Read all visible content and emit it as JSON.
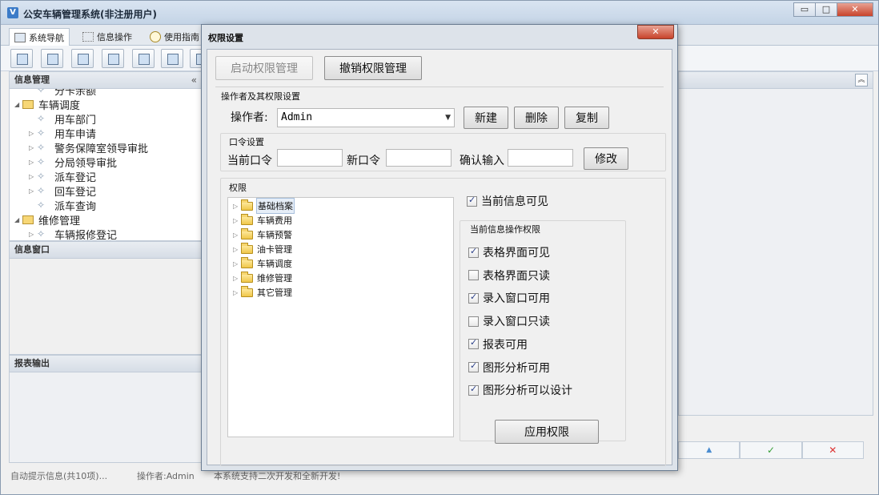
{
  "app": {
    "title": "公安车辆管理系统(非注册用户)",
    "icon": "app-logo-icon",
    "window_controls": {
      "minimize": "▭",
      "maximize": "□",
      "close": "✕"
    }
  },
  "tabs": [
    {
      "label": "系统导航",
      "icon": "monitor-icon"
    },
    {
      "label": "信息操作",
      "icon": "grid-icon"
    },
    {
      "label": "使用指南",
      "icon": "clock-icon"
    }
  ],
  "left": {
    "info_title": "信息管理",
    "collapse_glyph": "«",
    "tree": [
      {
        "label": "分卡余额",
        "level": 1,
        "kind": "tool",
        "arrow": ""
      },
      {
        "label": "车辆调度",
        "level": 0,
        "kind": "folder",
        "arrow": "◢"
      },
      {
        "label": "用车部门",
        "level": 1,
        "kind": "tool",
        "arrow": ""
      },
      {
        "label": "用车申请",
        "level": 1,
        "kind": "tool",
        "arrow": "▷"
      },
      {
        "label": "警务保障室领导审批",
        "level": 1,
        "kind": "tool",
        "arrow": "▷"
      },
      {
        "label": "分局领导审批",
        "level": 1,
        "kind": "tool",
        "arrow": "▷"
      },
      {
        "label": "派车登记",
        "level": 1,
        "kind": "tool",
        "arrow": "▷"
      },
      {
        "label": "回车登记",
        "level": 1,
        "kind": "tool",
        "arrow": "▷"
      },
      {
        "label": "派车查询",
        "level": 1,
        "kind": "tool",
        "arrow": ""
      },
      {
        "label": "维修管理",
        "level": 0,
        "kind": "folder",
        "arrow": "◢"
      },
      {
        "label": "车辆报修登记",
        "level": 1,
        "kind": "tool",
        "arrow": "▷"
      }
    ],
    "window_title": "信息窗口",
    "report_title": "报表输出"
  },
  "right": {
    "up_glyph": "︽",
    "actions": {
      "up": "▲",
      "ok": "✓",
      "cancel": "✕"
    }
  },
  "status": {
    "hint": "自动提示信息(共10项)...",
    "operator": "操作者:Admin",
    "notice": "本系统支持二次开发和全新开发!"
  },
  "dialog": {
    "title": "权限设置",
    "close": "✕",
    "start_btn": "启动权限管理",
    "revoke_btn": "撤销权限管理",
    "operator_section": "操作者及其权限设置",
    "operator_label": "操作者:",
    "operator_value": "Admin",
    "dropdown_glyph": "▼",
    "new_btn": "新建",
    "delete_btn": "删除",
    "copy_btn": "复制",
    "password_section": "口令设置",
    "current_pwd": "当前口令",
    "new_pwd": "新口令",
    "confirm_pwd": "确认输入",
    "modify_btn": "修改",
    "perm_section": "权限",
    "perm_tree": [
      {
        "label": "基础档案",
        "selected": true
      },
      {
        "label": "车辆费用",
        "selected": false
      },
      {
        "label": "车辆预警",
        "selected": false
      },
      {
        "label": "油卡管理",
        "selected": false
      },
      {
        "label": "车辆调度",
        "selected": false
      },
      {
        "label": "维修管理",
        "selected": false
      },
      {
        "label": "其它管理",
        "selected": false
      }
    ],
    "tree_arrow": "▷",
    "visible_label": "当前信息可见",
    "visible_checked": true,
    "ops_section": "当前信息操作权限",
    "ops": [
      {
        "label": "表格界面可见",
        "checked": true
      },
      {
        "label": "表格界面只读",
        "checked": false
      },
      {
        "label": "录入窗口可用",
        "checked": true
      },
      {
        "label": "录入窗口只读",
        "checked": false
      },
      {
        "label": "报表可用",
        "checked": true
      },
      {
        "label": "图形分析可用",
        "checked": true
      },
      {
        "label": "图形分析可以设计",
        "checked": true
      }
    ],
    "apply_btn": "应用权限"
  }
}
